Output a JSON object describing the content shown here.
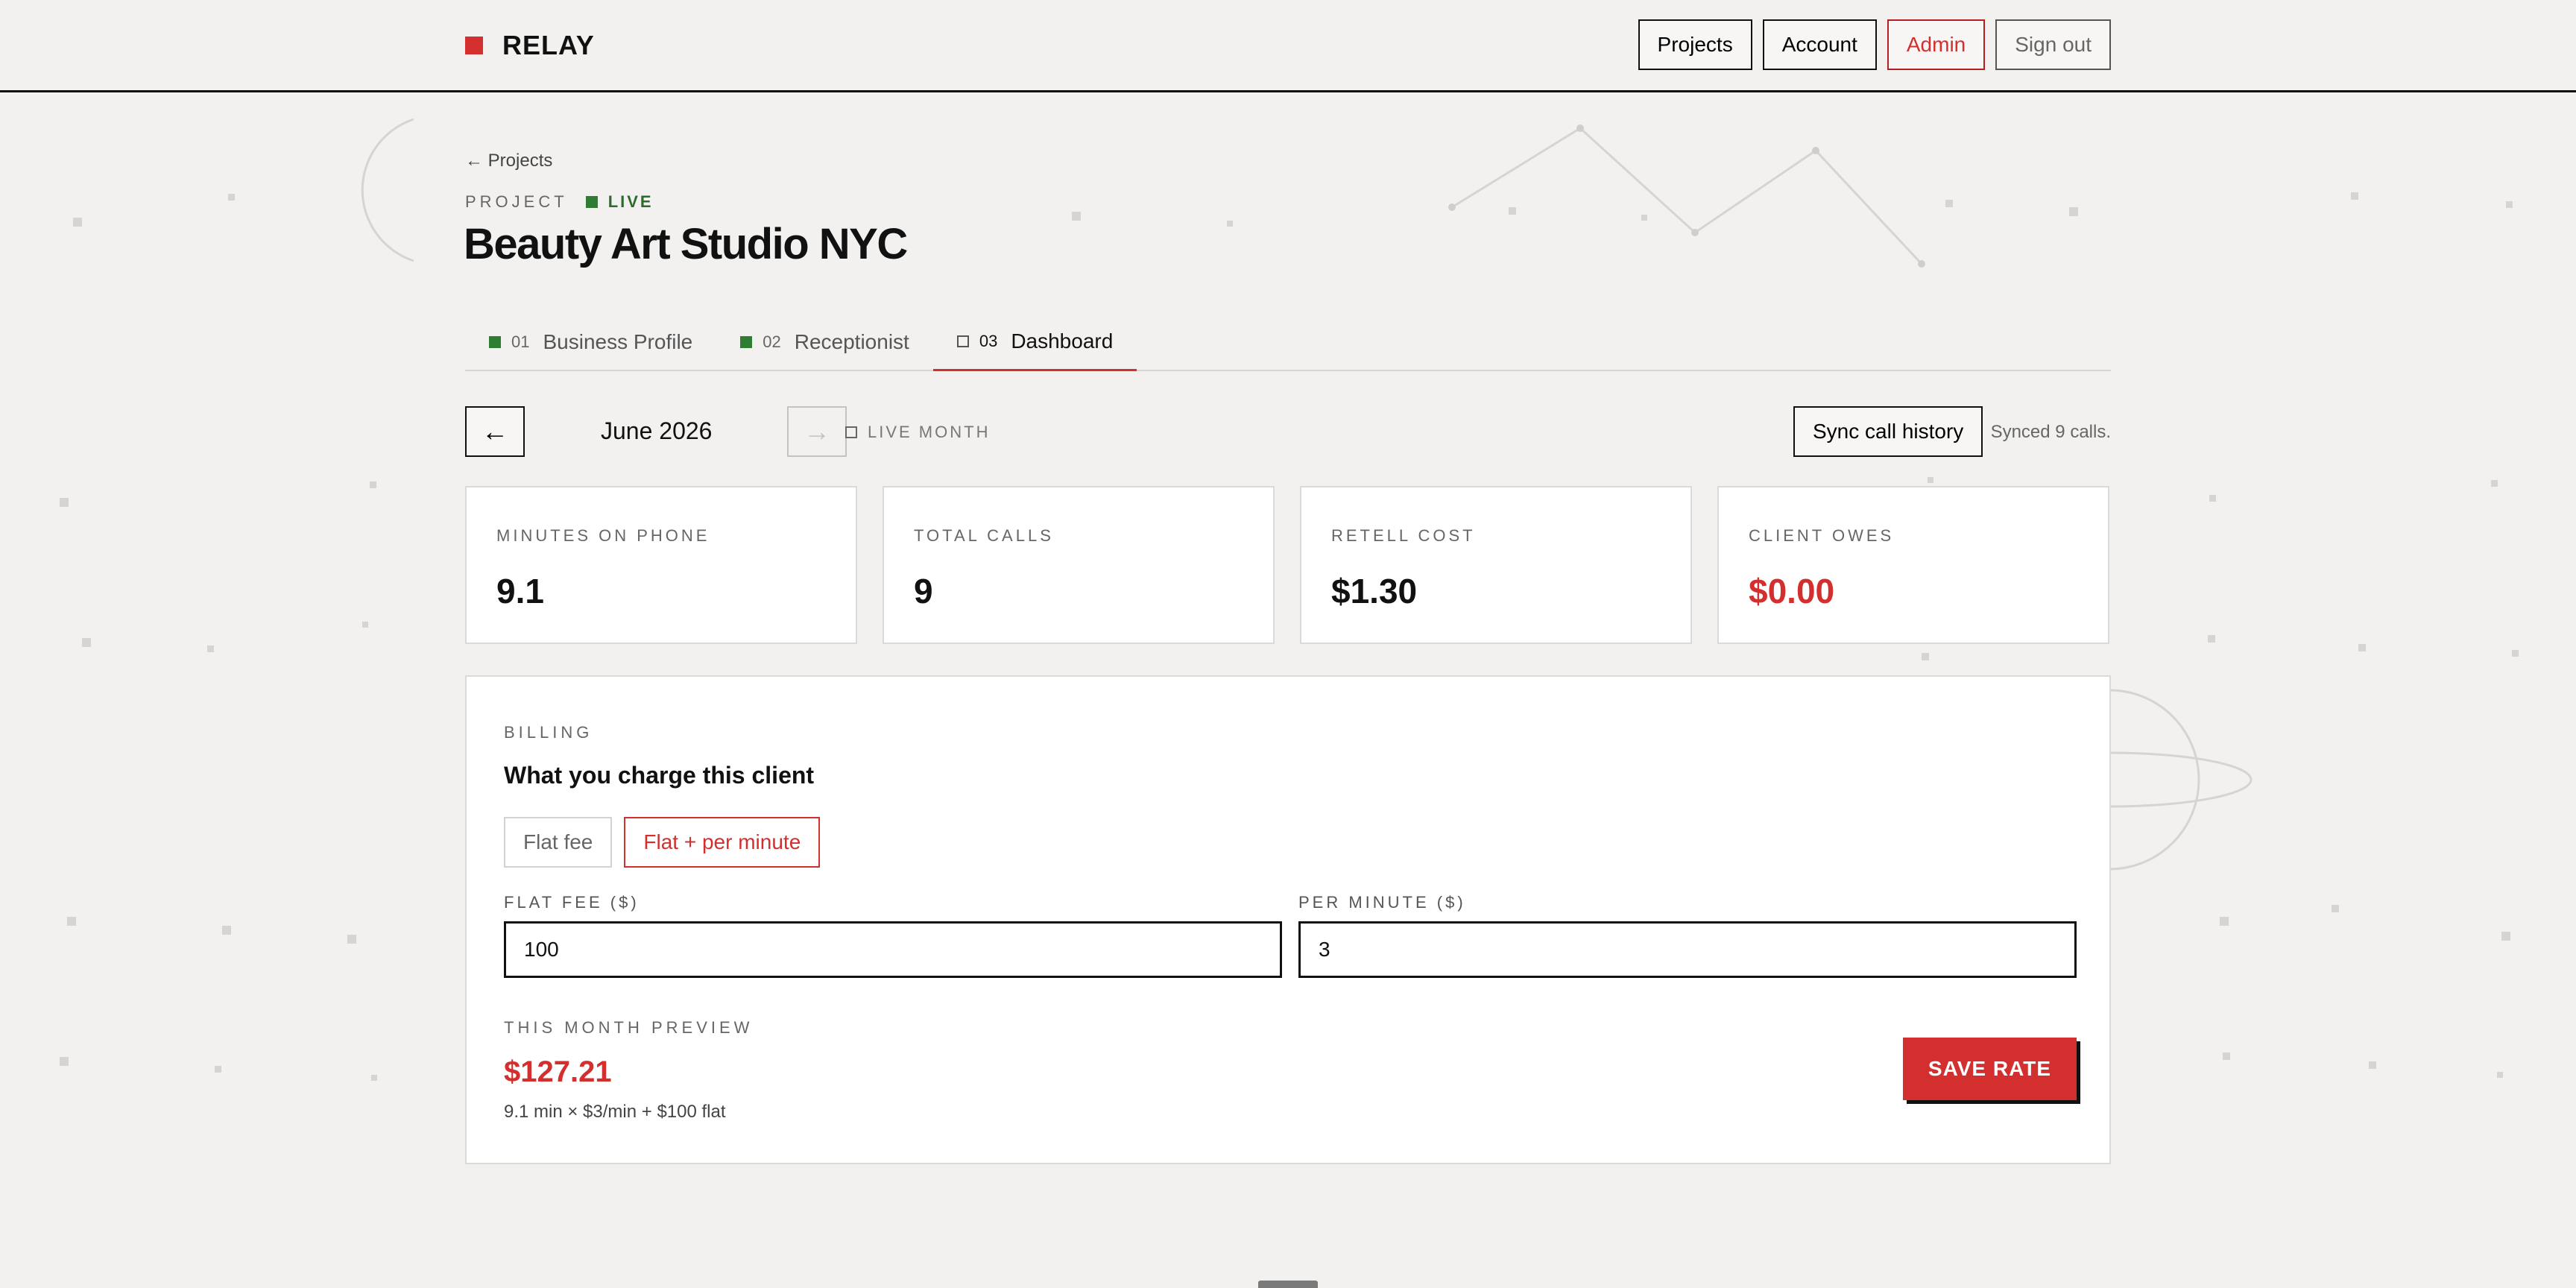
{
  "brand": {
    "name": "RELAY"
  },
  "nav": {
    "projects": "Projects",
    "account": "Account",
    "admin": "Admin",
    "sign_out": "Sign out"
  },
  "breadcrumb": {
    "back": "← Projects"
  },
  "project": {
    "eyebrow": "PROJECT",
    "status": "LIVE",
    "title": "Beauty Art Studio NYC"
  },
  "tabs": [
    {
      "num": "01",
      "label": "Business Profile",
      "done": true
    },
    {
      "num": "02",
      "label": "Receptionist",
      "done": true
    },
    {
      "num": "03",
      "label": "Dashboard",
      "done": false,
      "active": true
    }
  ],
  "month": {
    "prev": "←",
    "label": "June 2026",
    "next": "→",
    "live_label": "LIVE MONTH"
  },
  "sync": {
    "button": "Sync call history",
    "note": "Synced 9 calls."
  },
  "stats": [
    {
      "label": "MINUTES ON PHONE",
      "value": "9.1"
    },
    {
      "label": "TOTAL CALLS",
      "value": "9"
    },
    {
      "label": "RETELL COST",
      "value": "$1.30"
    },
    {
      "label": "CLIENT OWES",
      "value": "$0.00"
    }
  ],
  "billing": {
    "eyebrow": "BILLING",
    "title": "What you charge this client",
    "modes": [
      "Flat fee",
      "Flat + per minute"
    ],
    "selected_mode": "Flat + per minute",
    "flat_fee_label": "FLAT FEE ($)",
    "flat_fee_value": "100",
    "per_minute_label": "PER MINUTE ($)",
    "per_minute_value": "3",
    "preview_label": "THIS MONTH PREVIEW",
    "preview_amount": "$127.21",
    "preview_formula": "9.1 min × $3/min + $100 flat",
    "save_button": "SAVE RATE"
  },
  "colors": {
    "accent": "#d32f2f",
    "live": "#2e7d32",
    "background": "#f2f1ef"
  }
}
